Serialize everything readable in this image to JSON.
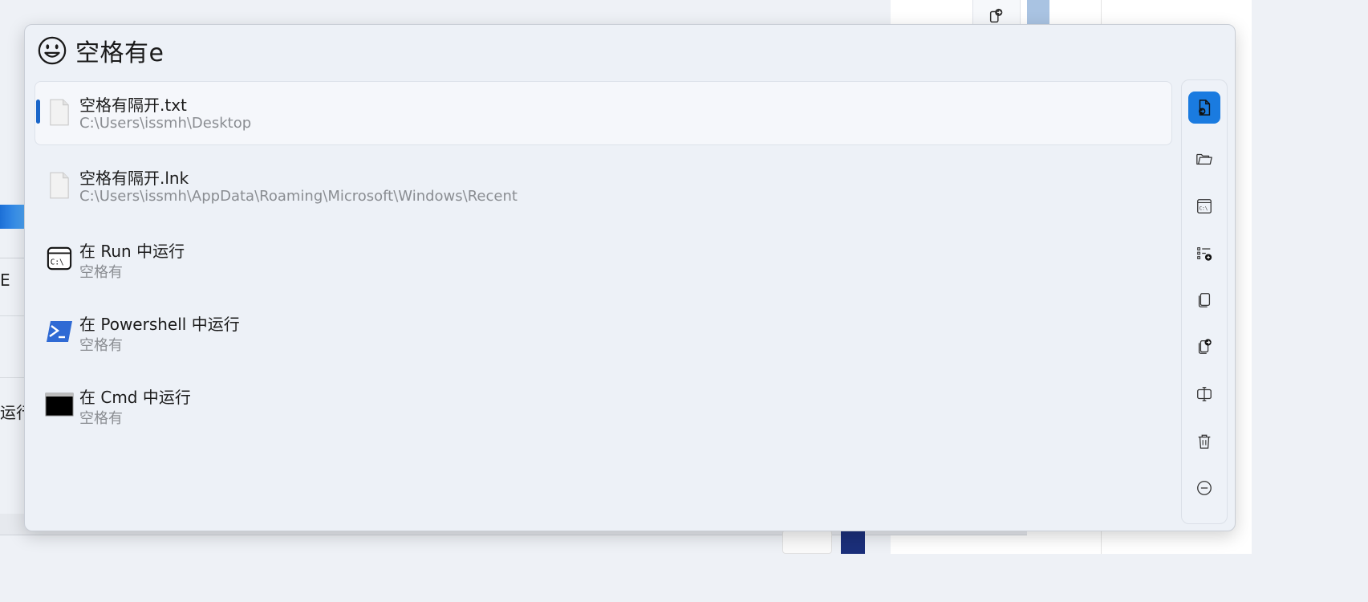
{
  "query": "空格有e",
  "results": [
    {
      "title": "空格有隔开.txt",
      "subtitle": "C:\\Users\\issmh\\Desktop",
      "icon": "text-file-icon",
      "selected": true
    },
    {
      "title": "空格有隔开.lnk",
      "subtitle": "C:\\Users\\issmh\\AppData\\Roaming\\Microsoft\\Windows\\Recent",
      "icon": "shortcut-file-icon",
      "selected": false
    },
    {
      "title": "在 Run 中运行",
      "subtitle": "空格有",
      "icon": "run-dialog-icon",
      "selected": false
    },
    {
      "title": "在 Powershell 中运行",
      "subtitle": "空格有",
      "icon": "powershell-icon",
      "selected": false
    },
    {
      "title": "在 Cmd 中运行",
      "subtitle": "空格有",
      "icon": "cmd-icon",
      "selected": false
    }
  ],
  "actions": [
    {
      "name": "open-file-action-icon",
      "active": true
    },
    {
      "name": "open-folder-icon",
      "active": false
    },
    {
      "name": "console-icon",
      "active": false
    },
    {
      "name": "add-to-list-icon",
      "active": false
    },
    {
      "name": "copy-icon",
      "active": false
    },
    {
      "name": "copy-path-icon",
      "active": false
    },
    {
      "name": "rename-icon",
      "active": false
    },
    {
      "name": "delete-icon",
      "active": false
    },
    {
      "name": "remove-icon",
      "active": false
    }
  ],
  "background": {
    "left_char_1": "E",
    "left_char_2": "运行"
  },
  "colors": {
    "accent": "#1a7be0",
    "selection_bar": "#1a66c9",
    "window_bg": "#edf1f7",
    "subtitle": "#8a8d92"
  }
}
